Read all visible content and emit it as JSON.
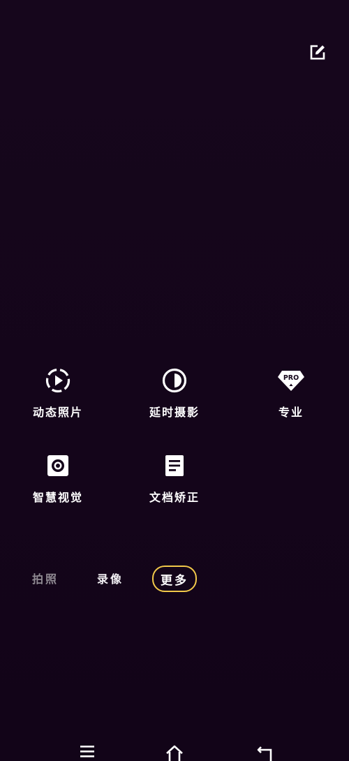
{
  "header": {
    "edit_icon": "edit-icon"
  },
  "modes": [
    {
      "label": "动态照片",
      "icon": "live-photo-icon"
    },
    {
      "label": "延时摄影",
      "icon": "timelapse-icon"
    },
    {
      "label": "专业",
      "icon": "pro-badge-icon",
      "badge_text": "PRO"
    },
    {
      "label": "智慧视觉",
      "icon": "smart-vision-icon"
    },
    {
      "label": "文档矫正",
      "icon": "document-icon"
    }
  ],
  "tabs": {
    "photo": "拍照",
    "video": "录像",
    "more": "更多",
    "active": "more",
    "active_color": "#f1c94a"
  },
  "navbar": {
    "menu_icon": "menu-icon",
    "home_icon": "home-icon",
    "back_icon": "back-icon"
  }
}
